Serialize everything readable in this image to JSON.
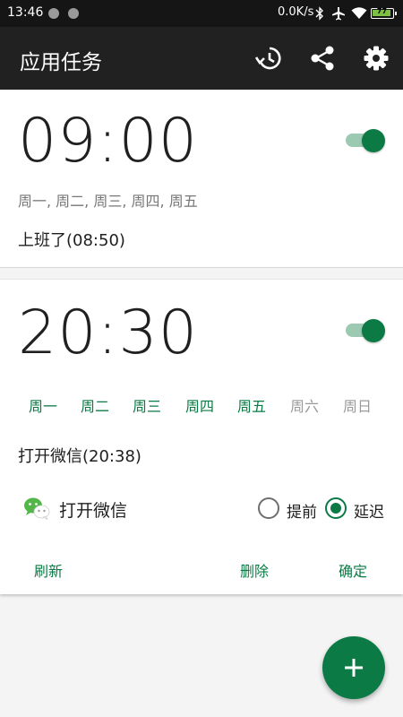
{
  "status_bar": {
    "time": "13:46",
    "net_speed": "0.0K/s",
    "battery": "77"
  },
  "app_bar": {
    "title": "应用任务",
    "actions": [
      "history-icon",
      "share-icon",
      "settings-icon"
    ]
  },
  "tasks": [
    {
      "time": "09:00",
      "enabled": true,
      "days_summary": "周一, 周二, 周三, 周四, 周五",
      "label": "上班了(08:50)"
    },
    {
      "time": "20:30",
      "enabled": true,
      "days": [
        {
          "label": "周一",
          "on": true
        },
        {
          "label": "周二",
          "on": true
        },
        {
          "label": "周三",
          "on": true
        },
        {
          "label": "周四",
          "on": true
        },
        {
          "label": "周五",
          "on": true
        },
        {
          "label": "周六",
          "on": false
        },
        {
          "label": "周日",
          "on": false
        }
      ],
      "label": "打开微信(20:38)",
      "app_name": "打开微信",
      "options": {
        "before": "提前",
        "after": "延迟",
        "selected": "延迟"
      },
      "buttons": {
        "refresh": "刷新",
        "delete": "删除",
        "confirm": "确定"
      }
    }
  ],
  "colors": {
    "accent": "#0b7a45",
    "toolbar": "#212121",
    "statusbar": "#151515"
  }
}
